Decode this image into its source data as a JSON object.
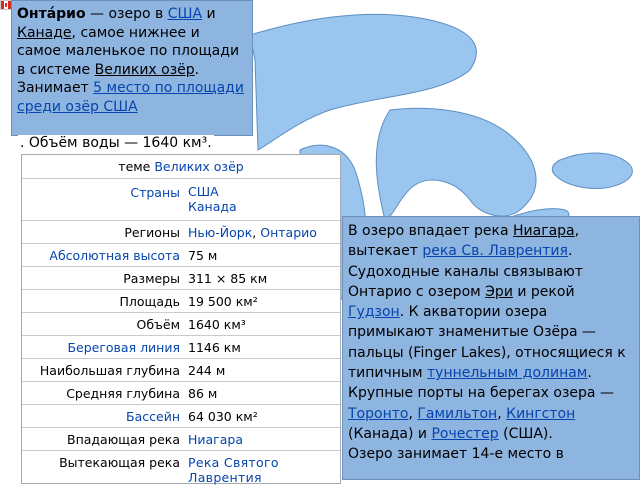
{
  "colors": {
    "water": "#9ac5ee",
    "land": "#ffffff",
    "popup": "#8eb4e0",
    "link": "#0645ad"
  },
  "flag": {
    "icon": "canada-flag-icon"
  },
  "intro": {
    "name": "Онта́рио",
    "dash": " — озеро в ",
    "link_usa": "США",
    "and": " и ",
    "link_canada": "Канаде",
    "t1": ", самое нижнее и самое маленькое по площади в системе ",
    "link_great_lakes": "Великих озёр",
    "t2": ". Занимает ",
    "link_rank": "5 место по площади среди озёр США",
    "tail": ". Объём воды — 1640 км³."
  },
  "infobox": {
    "header_prefix": "теме ",
    "header_link": "Великих озёр",
    "rows": [
      {
        "label": "Страны",
        "value_1": "США",
        "value_2": "Канада"
      },
      {
        "label": "Регионы",
        "value_1": "Нью-Йорк",
        "sep": ", ",
        "value_2": "Онтарио"
      },
      {
        "label": "Абсолютная высота",
        "value": "75 м"
      },
      {
        "label": "Размеры",
        "value": "311 × 85 км"
      },
      {
        "label": "Площадь",
        "value": "19 500 км²"
      },
      {
        "label": "Объём",
        "value": "1640 км³"
      },
      {
        "label": "Береговая линия",
        "value": "1146 км"
      },
      {
        "label": "Наибольшая глубина",
        "value": "244 м"
      },
      {
        "label": "Средняя глубина",
        "value": "86 м"
      },
      {
        "label": "Бассейн",
        "value": "64 030 км²"
      },
      {
        "label": "Впадающая река",
        "value": "Ниагара"
      },
      {
        "label": "Вытекающая река",
        "value": "Река Святого Лаврентия"
      }
    ]
  },
  "right": {
    "p1": "В озеро впадает река ",
    "l_niagara": "Ниагара",
    "p2": ", вытекает ",
    "l_stlawrence": "река Св. Лаврентия",
    "p3": ". Судоходные каналы связывают Онтарио с озером ",
    "l_erie": "Эри",
    "p4": " и рекой ",
    "l_hudson": "Гудзон",
    "p5": ". К акватории озера примыкают знаменитые Озёра — пальцы (Finger Lakes), относящиеся к типичным ",
    "l_tunnel": "туннельным долинам",
    "p6": ".",
    "p7": "Крупные порты на берегах озера — ",
    "l_toronto": "Торонто",
    "c1": ", ",
    "l_hamilton": "Гамильтон",
    "c2": ", ",
    "l_kingston": "Кингстон",
    "p8": " (Канада) и ",
    "l_rochester": "Рочестер",
    "p9": " (США).",
    "p10": "Озеро занимает 14-е место в"
  }
}
